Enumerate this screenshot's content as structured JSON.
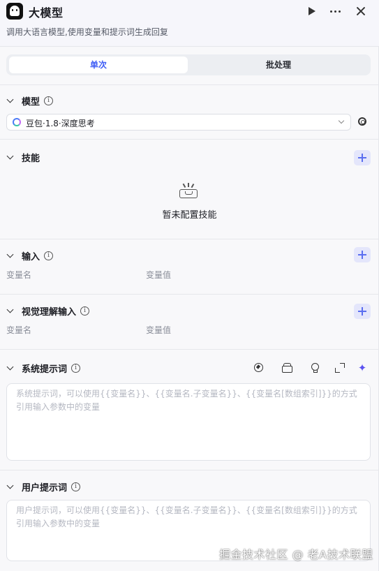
{
  "header": {
    "title": "大模型",
    "description": "调用大语言模型,使用变量和提示词生成回复",
    "run_icon": "play-icon",
    "more_icon": "more-icon",
    "close_icon": "close-icon"
  },
  "tabs": [
    {
      "label": "单次",
      "active": true
    },
    {
      "label": "批处理",
      "active": false
    }
  ],
  "model_section": {
    "title": "模型",
    "selected_model": "豆包·1.8·深度思考",
    "settings_icon": "gear-icon"
  },
  "skills_section": {
    "title": "技能",
    "empty_text": "暂未配置技能"
  },
  "input_section": {
    "title": "输入",
    "col_name": "变量名",
    "col_value": "变量值"
  },
  "vision_section": {
    "title": "视觉理解输入",
    "col_name": "变量名",
    "col_value": "变量值"
  },
  "system_prompt": {
    "title": "系统提示词",
    "placeholder": "系统提示词，可以使用{{变量名}}、{{变量名.子变量名}}、{{变量名[数组索引]}}的方式引用输入参数中的变量",
    "tools": [
      "compass-icon",
      "library-icon",
      "bulb-icon",
      "expand-icon",
      "magic-icon"
    ]
  },
  "user_prompt": {
    "title": "用户提示词",
    "placeholder": "用户提示词，可以使用{{变量名}}、{{变量名.子变量名}}、{{变量名[数组索引]}}的方式引用输入参数中的变量"
  },
  "watermark": "掘金技术社区 @ 老A技术联盟",
  "colors": {
    "accent": "#3d5cf5",
    "add_button_bg": "#e4e6fb",
    "panel_bg": "#f8f8fa"
  }
}
